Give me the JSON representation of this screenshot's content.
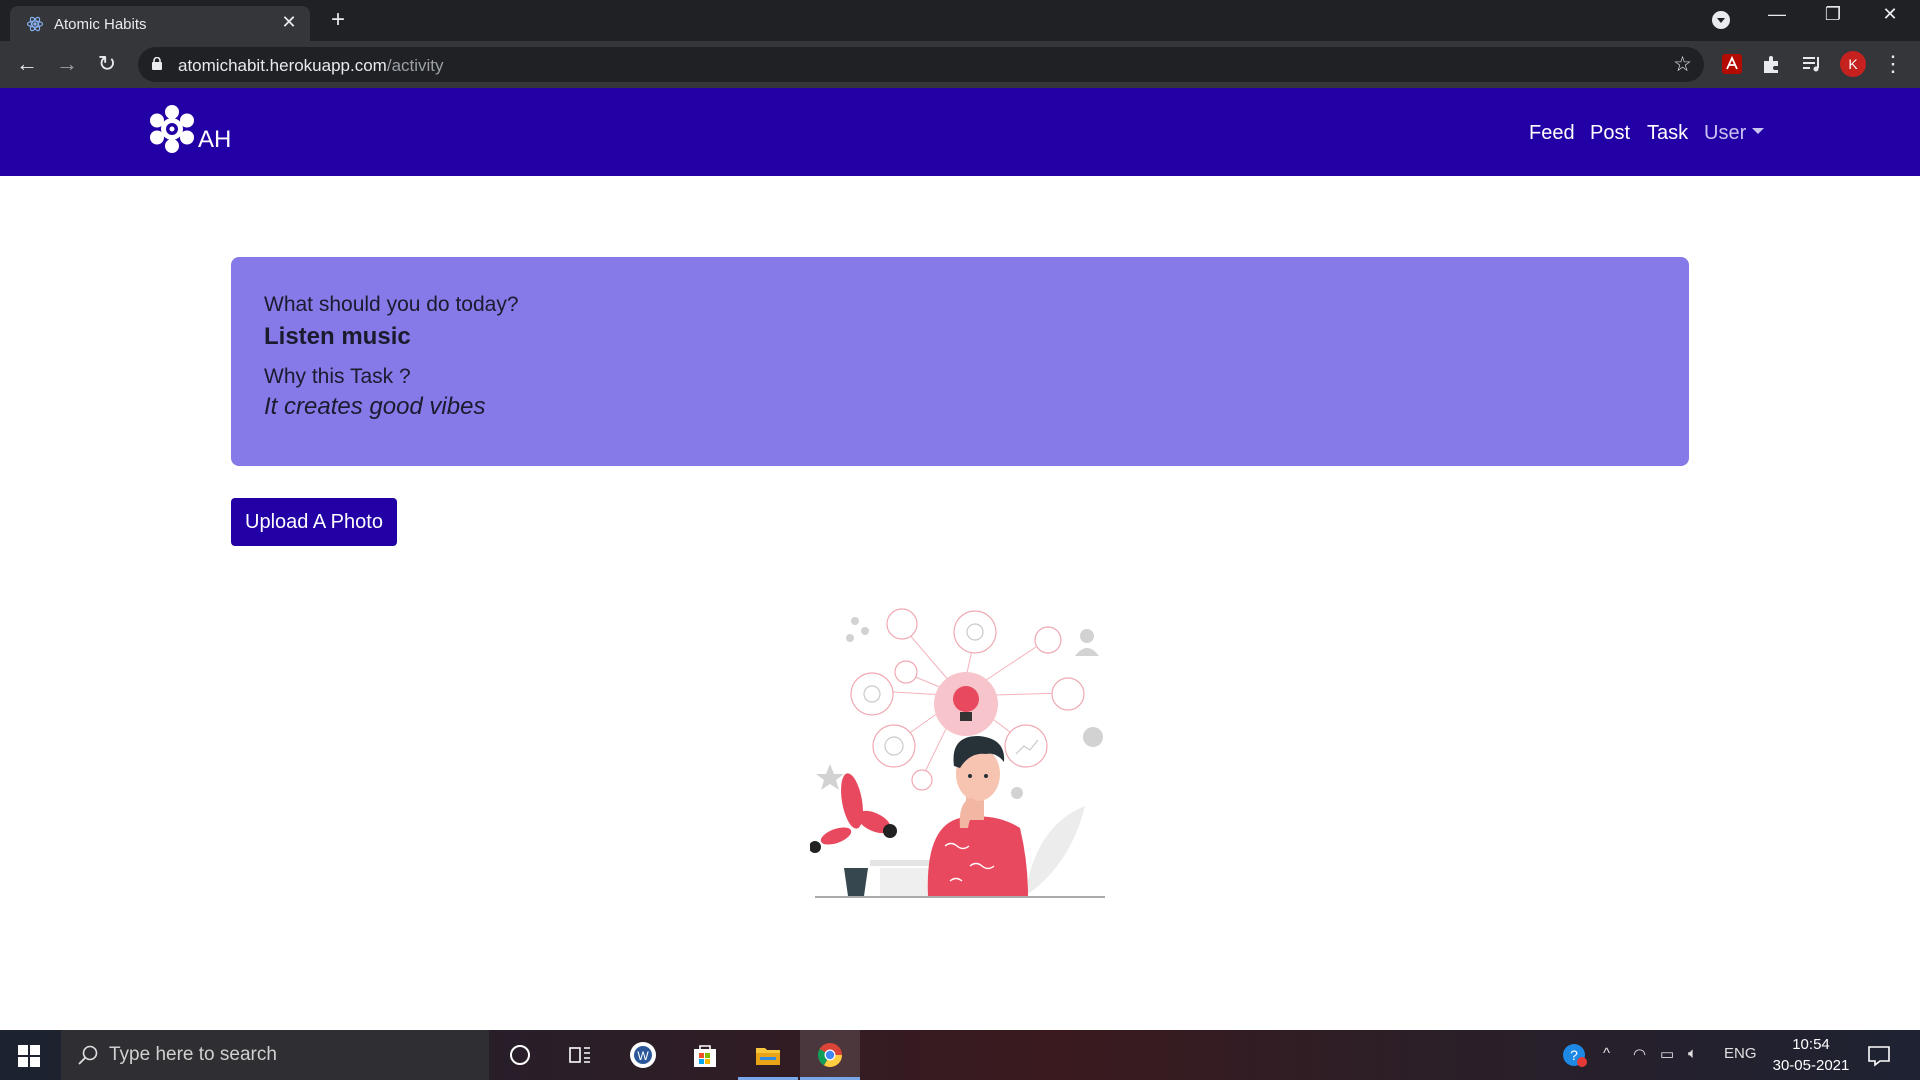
{
  "browser": {
    "tab_title": "Atomic Habits",
    "url_host": "atomichabit.herokuapp.com",
    "url_path": "/activity",
    "profile_initial": "K"
  },
  "navbar": {
    "brand": "AH",
    "links": [
      "Feed",
      "Post",
      "Task"
    ],
    "user_menu": "User"
  },
  "card": {
    "question": "What should you do today?",
    "task": "Listen music",
    "why_label": "Why this Task ?",
    "reason": "It creates good vibes"
  },
  "upload_button": "Upload A Photo",
  "taskbar": {
    "search_placeholder": "Type here to search",
    "language": "ENG",
    "time": "10:54",
    "date": "30-05-2021"
  },
  "colors": {
    "navbar": "#2200a5",
    "card": "#857ae8",
    "button": "#2200a5"
  }
}
